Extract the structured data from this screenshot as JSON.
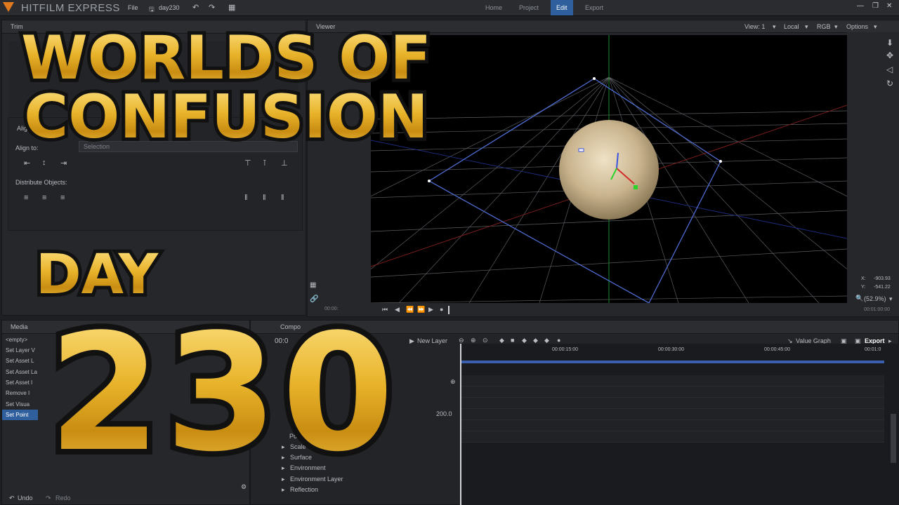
{
  "app": {
    "title": "HITFILM EXPRESS",
    "menu_file": "File",
    "project_name": "day230"
  },
  "workspace_tabs": [
    {
      "label": "Home",
      "active": false
    },
    {
      "label": "Project",
      "active": false
    },
    {
      "label": "Edit",
      "active": true
    },
    {
      "label": "Export",
      "active": false
    }
  ],
  "colors": {
    "accent": "#2f5f9c",
    "logo": "#e07a1f",
    "gold": "#e8b32a"
  },
  "left_panel": {
    "tab_trimmer": "Trim",
    "align_title": "Alig",
    "align_to_label": "Align to:",
    "align_to_value": "Selection",
    "distribute_label": "Distribute Objects:"
  },
  "viewer": {
    "tab_label": "Viewer",
    "view_option": "View: 1",
    "space_option": "Local",
    "channel_option": "RGB",
    "options_label": "Options",
    "coord_x_label": "X:",
    "coord_x": "-903.93",
    "coord_y_label": "Y:",
    "coord_y": "-541.22",
    "zoom": "(52.9%)",
    "time_start": "00:00:",
    "time_end": "00:01:00:00"
  },
  "history": {
    "tab_label": "Media",
    "items": [
      {
        "label": "<empty>",
        "selected": false
      },
      {
        "label": "Set Layer V",
        "selected": false
      },
      {
        "label": "Set Asset L",
        "selected": false
      },
      {
        "label": "Set Asset La",
        "selected": false
      },
      {
        "label": "Set Asset I",
        "selected": false
      },
      {
        "label": "Remove I",
        "selected": false
      },
      {
        "label": "Set Visua",
        "selected": false
      },
      {
        "label": "Set Point",
        "selected": true
      }
    ],
    "undo": "Undo",
    "redo": "Redo"
  },
  "composite": {
    "tab_label": "Compo",
    "time": "00:0",
    "new_layer": "New Layer",
    "value_graph": "Value Graph",
    "export": "Export",
    "value_200": "200.0",
    "layer_label": "Point",
    "properties": [
      "Scale",
      "Surface",
      "Environment",
      "Environment Layer",
      "Reflection"
    ],
    "ruler": [
      "00:00:15:00",
      "00:00:30:00",
      "00:00:45:00",
      "00:01:0"
    ]
  },
  "overlay": {
    "title_line1": "WORLDS OF",
    "title_line2": "CONFUSION",
    "day_label": "DAY",
    "day_number": "230"
  }
}
